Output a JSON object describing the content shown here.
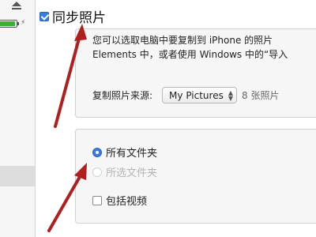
{
  "sidebar": {
    "eject_icon": "eject-icon",
    "battery_icon": "battery-icon",
    "battery_level": 0.9,
    "charge_icon": "lightning-icon",
    "charge_glyph": "⚡"
  },
  "sync_photos": {
    "label": "同步照片",
    "checked": true
  },
  "description": {
    "line1": "您可以选取电脑中要复制到 iPhone 的照片",
    "line2": "Elements 中，或者使用 Windows 中的“导入"
  },
  "source": {
    "label": "复制照片来源:",
    "selected": "My Pictures",
    "count_text": "8 张照片"
  },
  "options": {
    "all_folders": "所有文件夹",
    "selected_folders": "所选文件夹",
    "include_videos": "包括视频"
  },
  "colors": {
    "accent": "#3a7be0",
    "annotation_arrow": "#b01e1e",
    "battery_green": "#34b233"
  }
}
